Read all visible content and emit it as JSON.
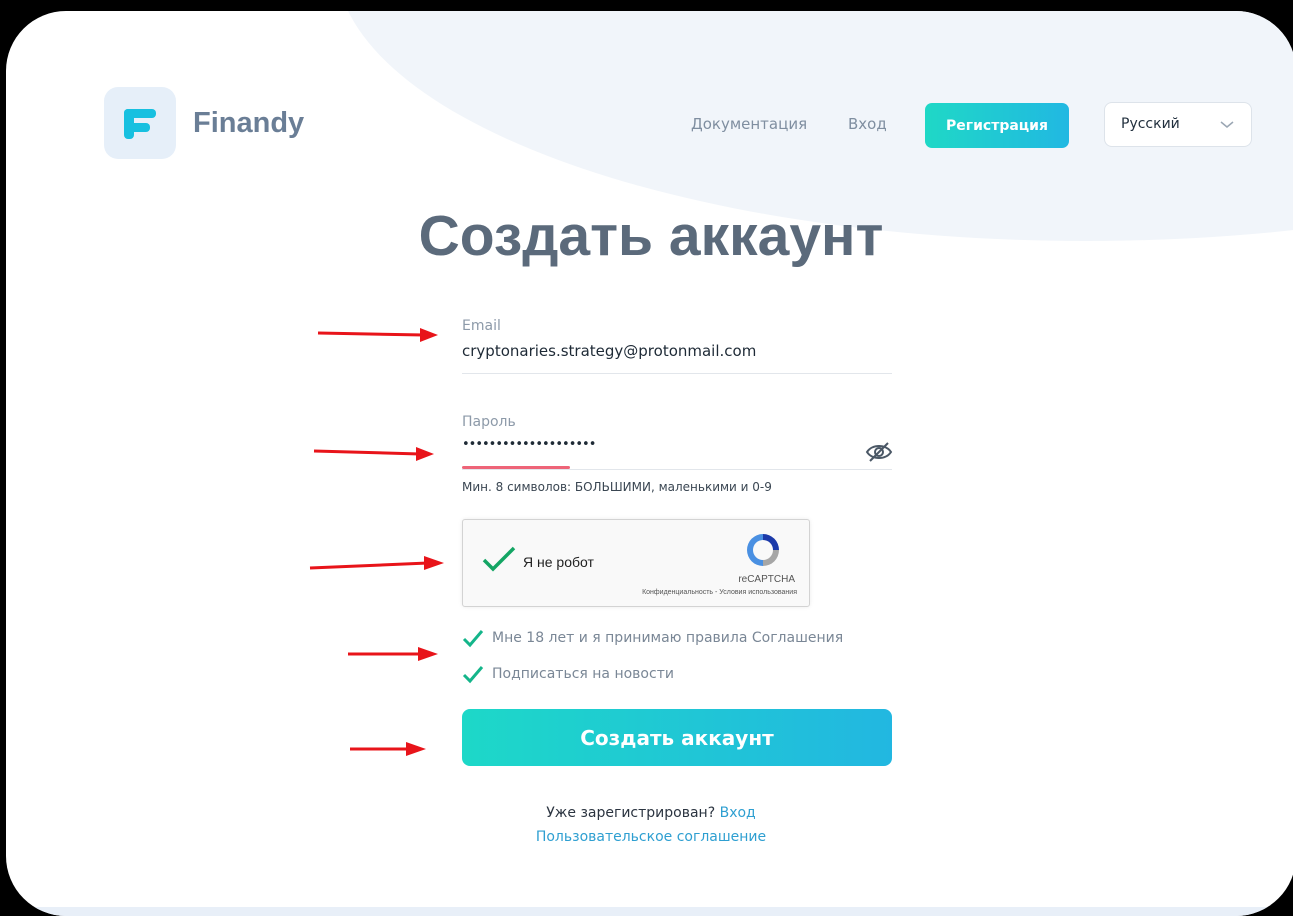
{
  "brand": {
    "name": "Finandy",
    "logo_icon": "finandy-f-logo"
  },
  "nav": {
    "docs_label": "Документация",
    "login_label": "Вход",
    "register_label": "Регистрация",
    "language_value": "Русский"
  },
  "page": {
    "title": "Создать аккаунт"
  },
  "form": {
    "email_label": "Email",
    "email_value": "cryptonaries.strategy@protonmail.com",
    "password_label": "Пароль",
    "password_value": "••••••••••••••••••••",
    "password_hint": "Мин. 8 символов: БОЛЬШИМИ, маленькими и 0-9",
    "agree_label": "Мне 18 лет и я принимаю правила Соглашения",
    "agree_checked": true,
    "news_label": "Подписаться на новости",
    "news_checked": true,
    "submit_label": "Создать аккаунт"
  },
  "captcha": {
    "label": "Я не робот",
    "brand": "reCAPTCHA",
    "terms": "Конфиденциальность - Условия использования",
    "checked": true
  },
  "footer": {
    "already_text": "Уже зарегистрирован?",
    "login_link": "Вход",
    "agreement_link": "Пользовательское соглашение"
  },
  "colors": {
    "accent_start": "#1fd8c6",
    "accent_end": "#21b8e2",
    "annotation_arrow": "#e8141a",
    "check_green": "#14b58a"
  }
}
